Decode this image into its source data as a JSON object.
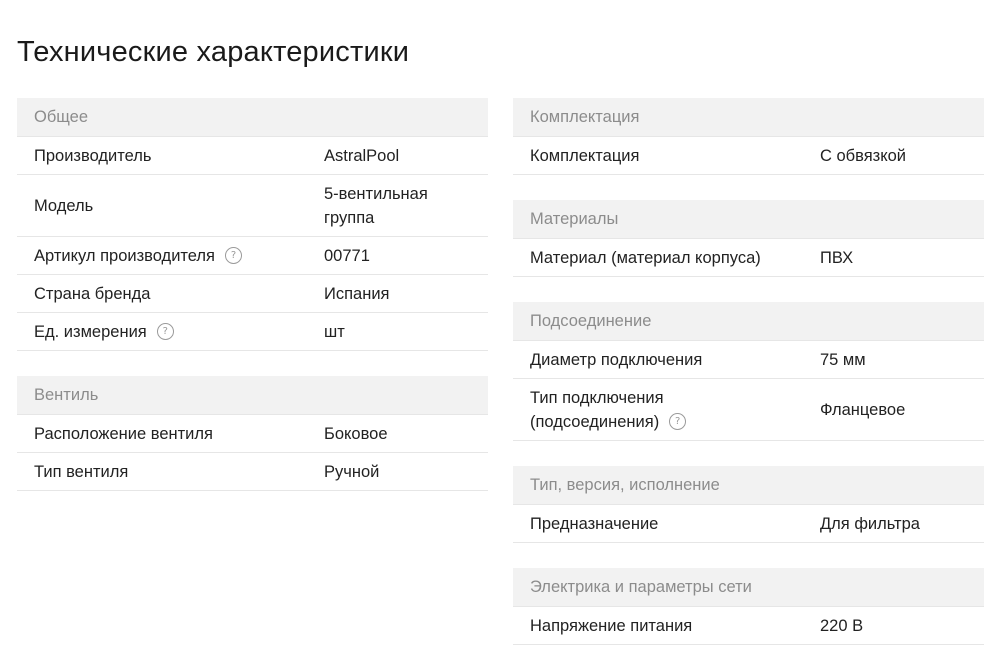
{
  "title": "Технические характеристики",
  "left_groups": [
    {
      "header": "Общее",
      "rows": [
        {
          "label": "Производитель",
          "value": "AstralPool"
        },
        {
          "label": "Модель",
          "value": "5-вентильная группа"
        },
        {
          "label": "Артикул производителя",
          "value": "00771",
          "help": "?"
        },
        {
          "label": "Страна бренда",
          "value": "Испания"
        },
        {
          "label": "Ед. измерения",
          "value": "шт",
          "help": "?"
        }
      ]
    },
    {
      "header": "Вентиль",
      "rows": [
        {
          "label": "Расположение вентиля",
          "value": "Боковое"
        },
        {
          "label": "Тип вентиля",
          "value": "Ручной"
        }
      ]
    }
  ],
  "right_groups": [
    {
      "header": "Комплектация",
      "rows": [
        {
          "label": "Комплектация",
          "value": "С обвязкой"
        }
      ]
    },
    {
      "header": "Материалы",
      "rows": [
        {
          "label": "Материал (материал корпуса)",
          "value": "ПВХ"
        }
      ]
    },
    {
      "header": "Подсоединение",
      "rows": [
        {
          "label": "Диаметр подключения",
          "value": "75 мм"
        },
        {
          "label_line1": "Тип подключения",
          "label_line2": "(подсоединения)",
          "value": "Фланцевое",
          "help": "?"
        }
      ]
    },
    {
      "header": "Тип, версия, исполнение",
      "rows": [
        {
          "label": "Предназначение",
          "value": "Для фильтра"
        }
      ]
    },
    {
      "header": "Электрика и параметры сети",
      "rows": [
        {
          "label": "Напряжение питания",
          "value": "220 В"
        }
      ]
    }
  ]
}
